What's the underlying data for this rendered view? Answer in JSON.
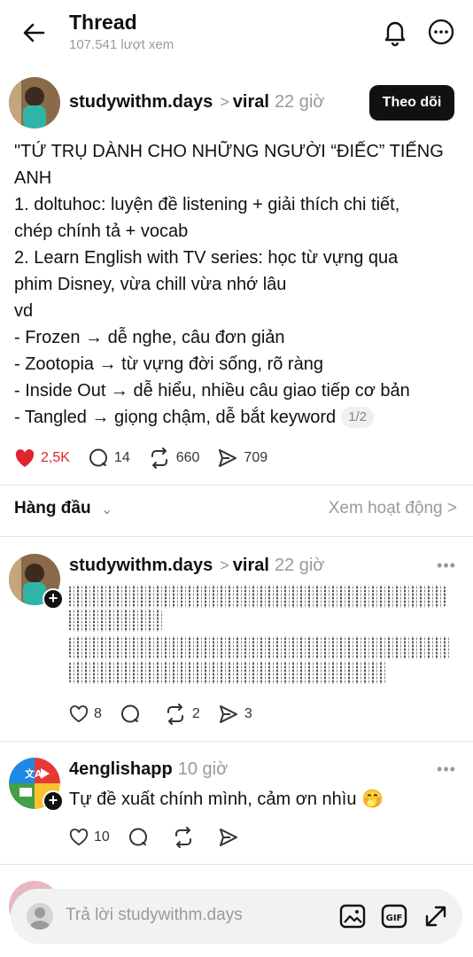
{
  "header": {
    "title": "Thread",
    "views": "107.541 lượt xem"
  },
  "post": {
    "username": "studywithm.days",
    "tag": "viral",
    "time": "22 giờ",
    "follow_label": "Theo dõi",
    "lines": [
      "\"TỨ TRỤ DÀNH CHO NHỮNG NGƯỜI “ĐIẾC” TIẾNG",
      "ANH",
      "1. doltuhoc: luyện đề listening + giải thích chi tiết,",
      "chép chính tả + vocab",
      "2. Learn English with TV series: học từ vựng qua",
      "phim Disney, vừa chill vừa nhớ lâu",
      "vd",
      "- Frozen → dễ nghe, câu đơn giản",
      "- Zootopia → từ vựng đời sống, rõ ràng",
      "- Inside Out → dễ hiểu, nhiều câu giao tiếp cơ bản",
      "- Tangled → giọng chậm, dễ bắt keyword"
    ],
    "page_indicator": "1/2",
    "likes": "2,5K",
    "comments": "14",
    "reposts": "660",
    "shares": "709"
  },
  "sort": {
    "label": "Hàng đầu",
    "activity_link": "Xem hoạt động"
  },
  "replies": [
    {
      "username": "studywithm.days",
      "tag": "viral",
      "time": "22 giờ",
      "likes": "8",
      "comments": "",
      "reposts": "2",
      "shares": "3"
    },
    {
      "username": "4englishapp",
      "time": "10 giờ",
      "text": "Tự  đề xuất chính mình, cảm ơn nhìu 🤭",
      "likes": "10"
    }
  ],
  "reply_bar": {
    "placeholder": "Trả lời studywithm.days"
  },
  "colors": {
    "like_red": "#e0242f",
    "follow_bg": "#111111",
    "muted_text": "#9a9a9a"
  },
  "icons": [
    "back-arrow-icon",
    "bell-icon",
    "more-circle-icon",
    "heart-icon",
    "comment-icon",
    "repost-icon",
    "share-icon",
    "image-icon",
    "gif-icon",
    "expand-icon"
  ]
}
